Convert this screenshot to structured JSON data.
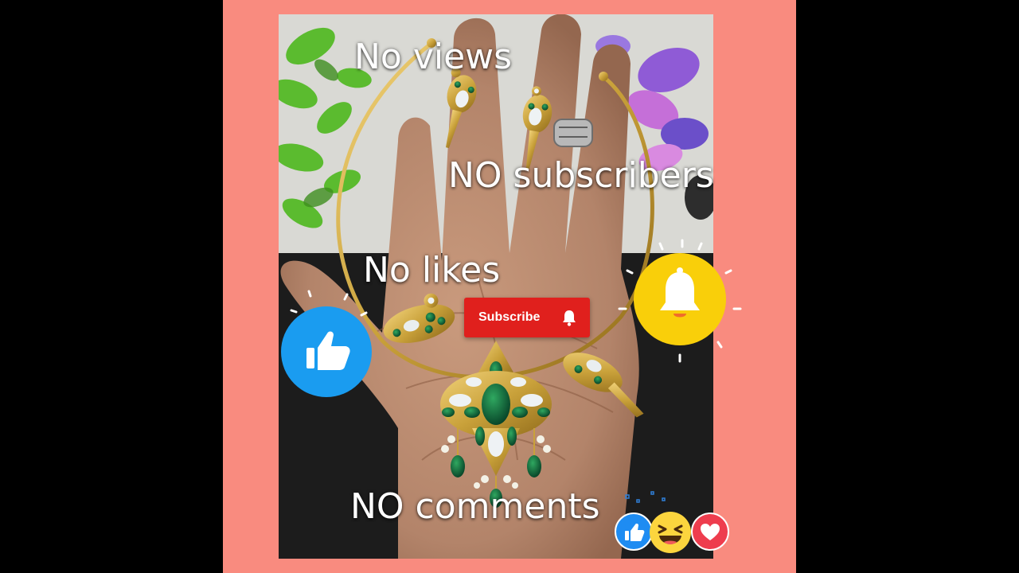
{
  "overlay": {
    "views": "No views",
    "subscribers": "NO subscribers",
    "likes": "No likes",
    "comments": "NO comments"
  },
  "subscribe_button": {
    "label": "Subscribe"
  },
  "icons": {
    "like": "thumbs-up-icon",
    "bell": "bell-icon",
    "reactions": [
      "like-reaction-icon",
      "haha-reaction-icon",
      "love-reaction-icon"
    ]
  },
  "colors": {
    "frame": "#f98b7f",
    "subscribe": "#e0201d",
    "like_circle": "#1a9cf0",
    "bell_circle": "#f9cf0a",
    "gold": "#c9a13a",
    "emerald": "#0f6b3a"
  }
}
